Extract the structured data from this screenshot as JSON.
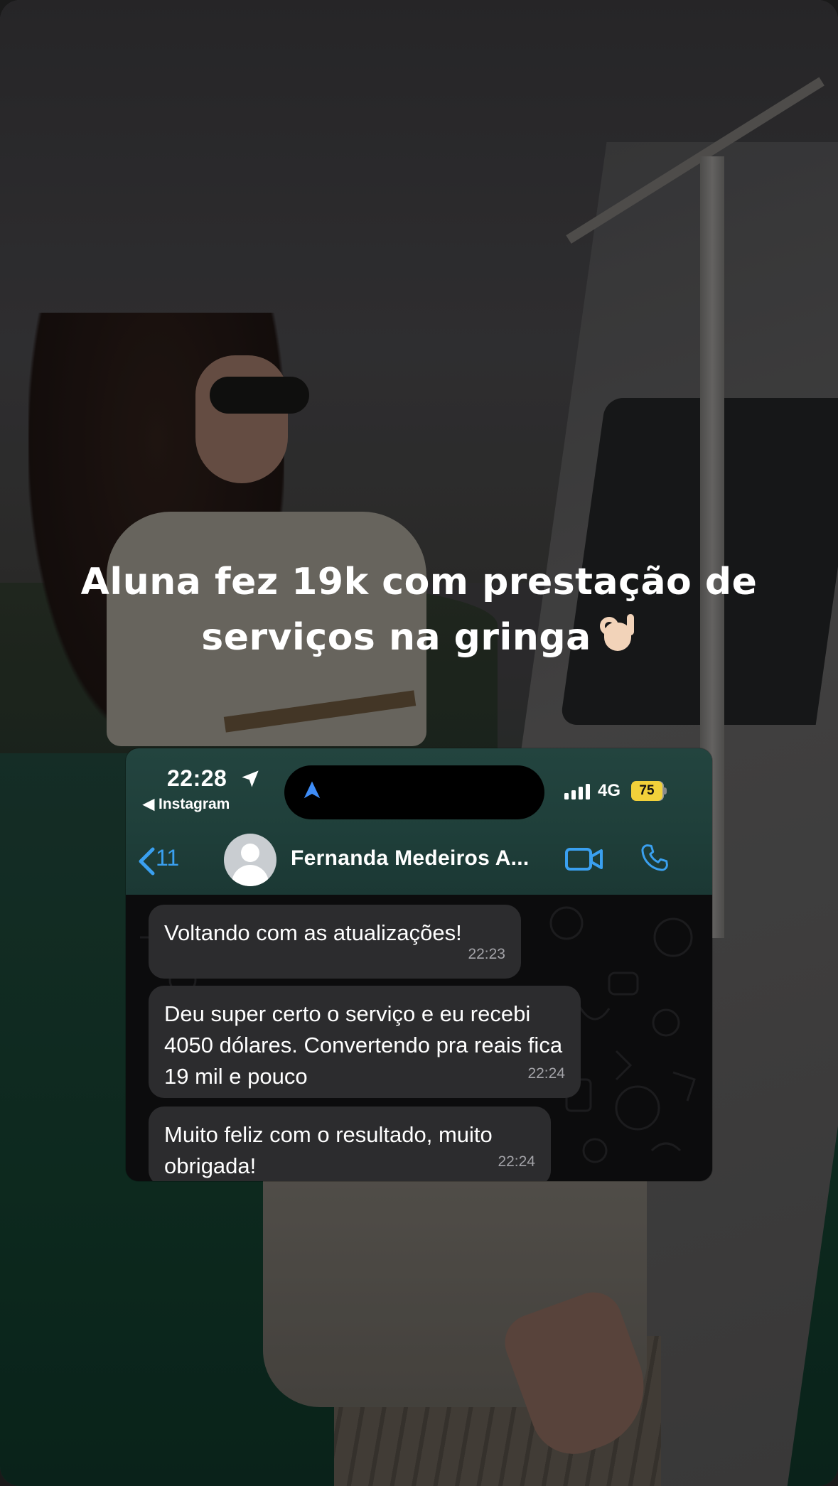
{
  "story": {
    "headline_line1": "Aluna fez 19k com prestação de",
    "headline_line2": "serviços na gringa",
    "headline_emoji": "ok-hand-icon"
  },
  "screenshot": {
    "status_bar": {
      "time": "22:28",
      "back_app": "◀ Instagram",
      "network": "4G",
      "battery": "75",
      "battery_color": "#f2d13a"
    },
    "chat_header": {
      "back_count": "11",
      "contact_name": "Fernanda Medeiros A...",
      "accent_color": "#3aa0f0"
    },
    "messages": [
      {
        "text": "Voltando com as atualizações!",
        "time": "22:23"
      },
      {
        "text": "Deu super certo o serviço e eu recebi 4050 dólares. Convertendo pra reais fica 19 mil e pouco",
        "time": "22:24"
      },
      {
        "text": "Muito feliz com o resultado, muito obrigada!",
        "time": "22:24"
      }
    ]
  }
}
